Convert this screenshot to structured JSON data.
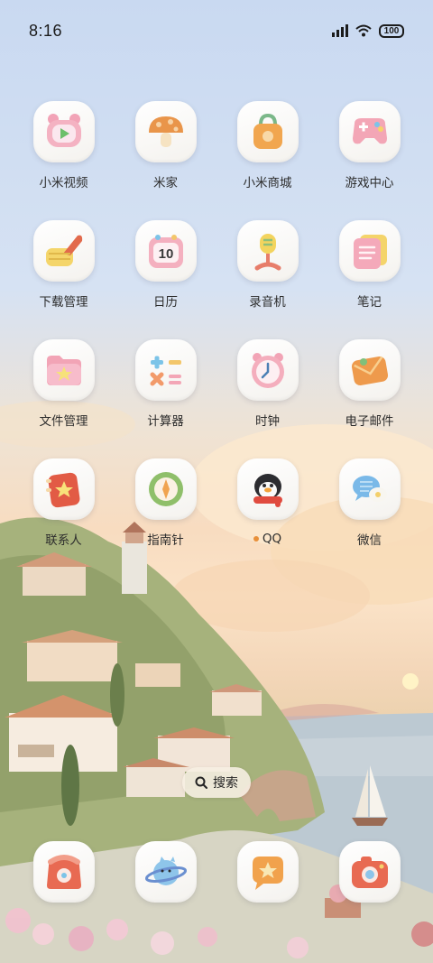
{
  "status_bar": {
    "time": "8:16",
    "battery": "100",
    "icons": [
      "signal-icon",
      "wifi-icon",
      "battery-icon"
    ]
  },
  "apps": [
    {
      "label": "小米视频",
      "icon": "video-icon"
    },
    {
      "label": "米家",
      "icon": "mushroom-icon"
    },
    {
      "label": "小米商城",
      "icon": "shopping-bag-icon"
    },
    {
      "label": "游戏中心",
      "icon": "gamepad-icon"
    },
    {
      "label": "下载管理",
      "icon": "download-hand-icon"
    },
    {
      "label": "日历",
      "icon": "calendar-icon",
      "calendar_day": "10"
    },
    {
      "label": "录音机",
      "icon": "microphone-icon"
    },
    {
      "label": "笔记",
      "icon": "notes-icon"
    },
    {
      "label": "文件管理",
      "icon": "folder-icon"
    },
    {
      "label": "计算器",
      "icon": "calculator-icon"
    },
    {
      "label": "时钟",
      "icon": "alarm-clock-icon"
    },
    {
      "label": "电子邮件",
      "icon": "mail-icon"
    },
    {
      "label": "联系人",
      "icon": "contacts-icon"
    },
    {
      "label": "指南针",
      "icon": "compass-icon"
    },
    {
      "label": "QQ",
      "icon": "penguin-icon",
      "new_install_dot": true
    },
    {
      "label": "微信",
      "icon": "chat-bubbles-icon"
    }
  ],
  "search": {
    "label": "搜索",
    "icon": "search-icon"
  },
  "dock": [
    {
      "icon": "phone-icon"
    },
    {
      "icon": "browser-planet-icon"
    },
    {
      "icon": "message-bubble-icon"
    },
    {
      "icon": "camera-icon"
    }
  ],
  "colors": {
    "label_text": "#2d2d2d",
    "notification_dot": "#e8903a",
    "tile_background": "#ffffff"
  }
}
